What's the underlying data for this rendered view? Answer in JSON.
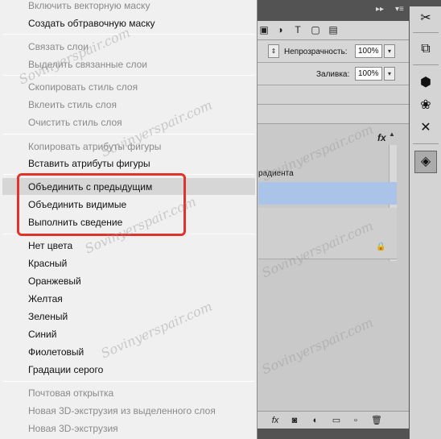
{
  "menu": {
    "items": [
      {
        "label": "Включить векторную маску",
        "disabled": true
      },
      {
        "label": "Создать обтравочную маску",
        "disabled": false
      },
      {
        "label": "Связать слои",
        "disabled": true
      },
      {
        "label": "Выделить связанные слои",
        "disabled": true
      },
      {
        "label": "Скопировать стиль слоя",
        "disabled": true
      },
      {
        "label": "Вклеить стиль слоя",
        "disabled": true
      },
      {
        "label": "Очистить стиль слоя",
        "disabled": true
      },
      {
        "label": "Копировать атрибуты фигуры",
        "disabled": true
      },
      {
        "label": "Вставить атрибуты фигуры",
        "disabled": false
      },
      {
        "label": "Объединить с предыдущим",
        "disabled": false
      },
      {
        "label": "Объединить видимые",
        "disabled": false
      },
      {
        "label": "Выполнить сведение",
        "disabled": false
      },
      {
        "label": "Нет цвета",
        "disabled": false
      },
      {
        "label": "Красный",
        "disabled": false
      },
      {
        "label": "Оранжевый",
        "disabled": false
      },
      {
        "label": "Желтая",
        "disabled": false
      },
      {
        "label": "Зеленый",
        "disabled": false
      },
      {
        "label": "Синий",
        "disabled": false
      },
      {
        "label": "Фиолетовый",
        "disabled": false
      },
      {
        "label": "Градации серого",
        "disabled": false
      },
      {
        "label": "Почтовая открытка",
        "disabled": true
      },
      {
        "label": "Новая 3D-экструзия из выделенного слоя",
        "disabled": true
      },
      {
        "label": "Новая 3D-экструзия",
        "disabled": true
      }
    ]
  },
  "layers_panel": {
    "opacity_label": "Непрозрачность:",
    "opacity_value": "100%",
    "fill_label": "Заливка:",
    "fill_value": "100%",
    "layer_name_fragment": "радиента",
    "fx_label": "fx"
  },
  "watermark": "Sovinyerspair.com",
  "colors": {
    "highlight_border": "#e0332b",
    "selected_layer": "#a9c4e8",
    "menu_bg": "#f0f0f0"
  }
}
